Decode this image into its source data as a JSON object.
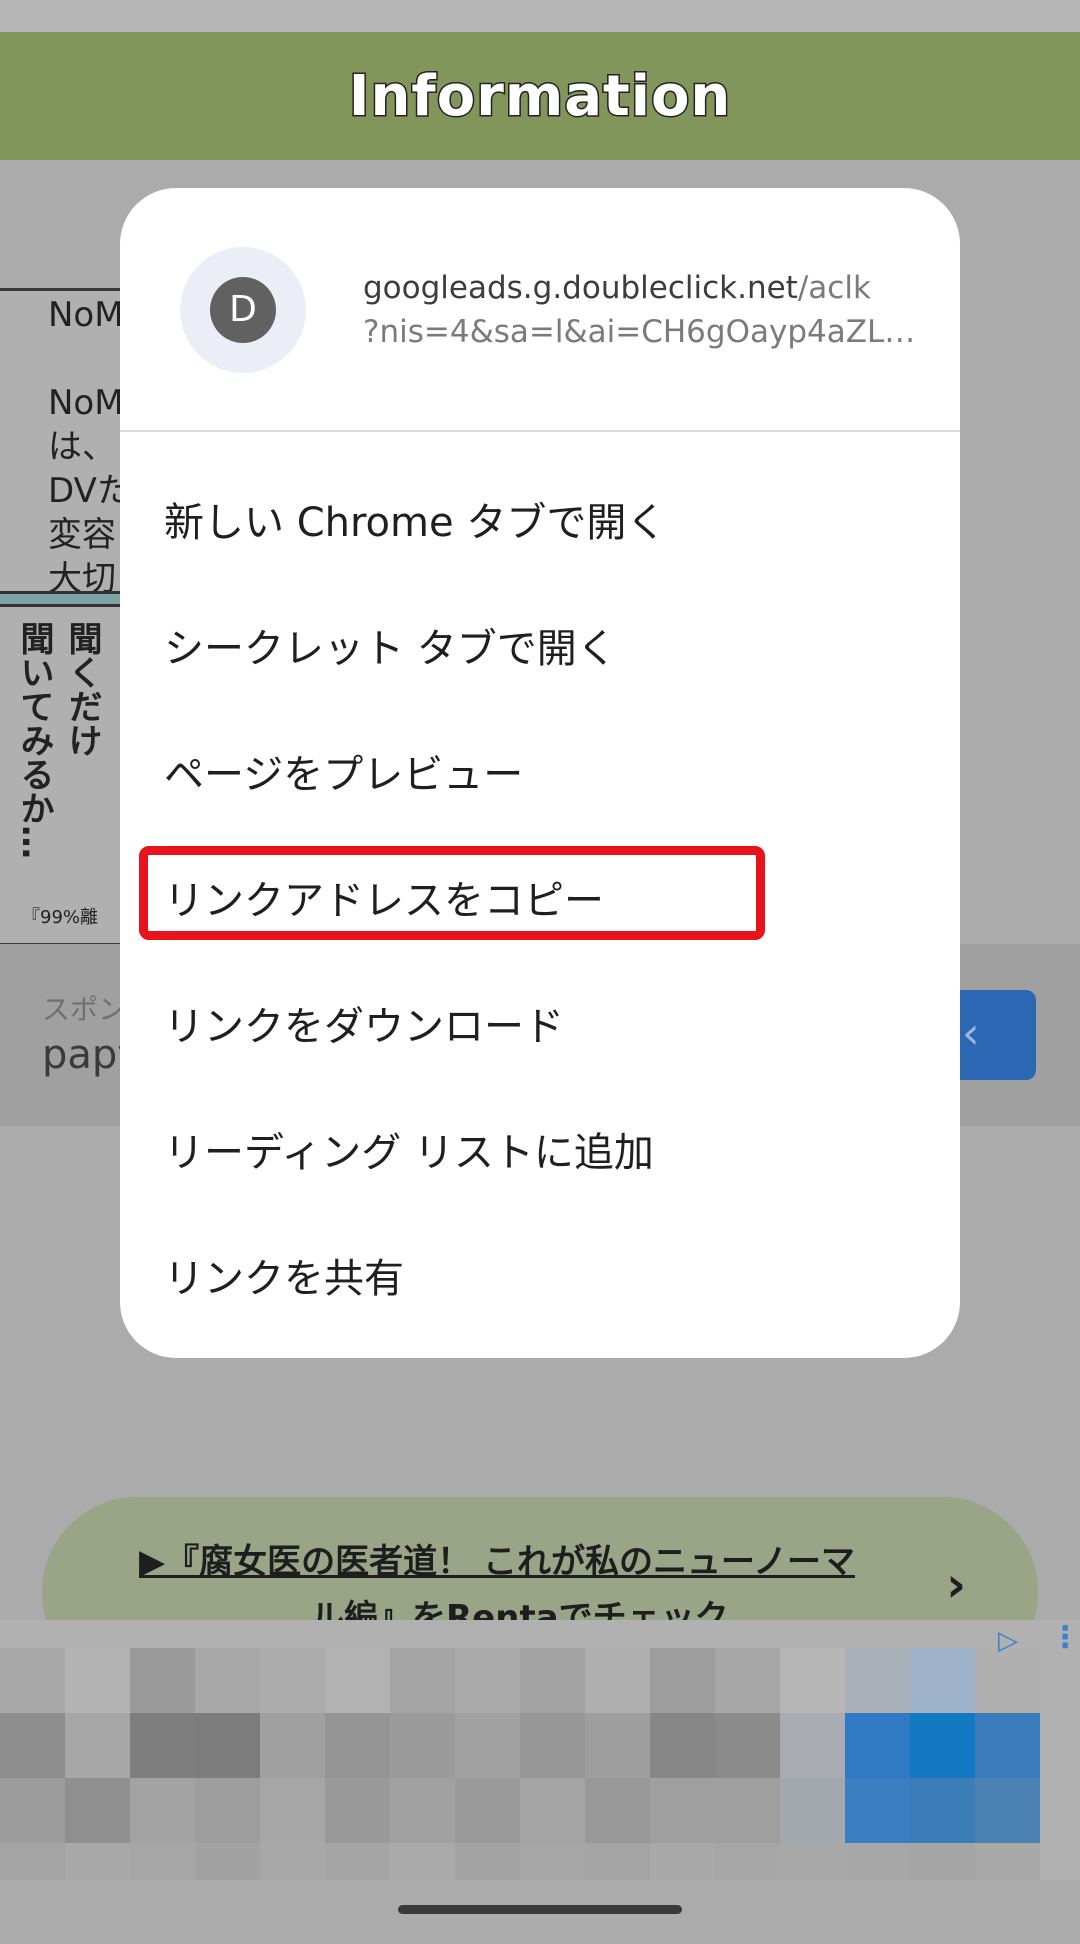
{
  "header": {
    "title": "Information"
  },
  "background_comic": {
    "text_lines": [
      "NoM",
      "",
      "NoM",
      "は、",
      "DVた",
      "変容",
      "大切"
    ],
    "vertical_text": [
      "聞くだけ",
      "聞いてみるか…"
    ],
    "caption": "『99%離"
  },
  "ad_banner": {
    "sponsor_label": "スポン",
    "brand": "papy"
  },
  "context_menu": {
    "url_host": "googleads.g.doubleclick.net",
    "url_path": "/aclk",
    "url_query": "?nis=4&sa=l&ai=CH6gOayp4aZLkl_...",
    "favicon_letter": "D",
    "items": [
      {
        "label": "新しい Chrome タブで開く"
      },
      {
        "label": "シークレット タブで開く"
      },
      {
        "label": "ページをプレビュー"
      },
      {
        "label": "リンクアドレスをコピー",
        "highlighted": true
      },
      {
        "label": "リンクをダウンロード"
      },
      {
        "label": "リーディング リストに追加"
      },
      {
        "label": "リンクを共有"
      }
    ]
  },
  "promo_link": {
    "line1": "▶『腐女医の医者道！ これが私のニューノーマ",
    "line2": "ル編』をRentaでチェック"
  },
  "colors": {
    "header_bg": "#82965b",
    "highlight_border": "#e8141c",
    "dim_overlay": "#ababab",
    "ad_button": "#2c67b4"
  }
}
